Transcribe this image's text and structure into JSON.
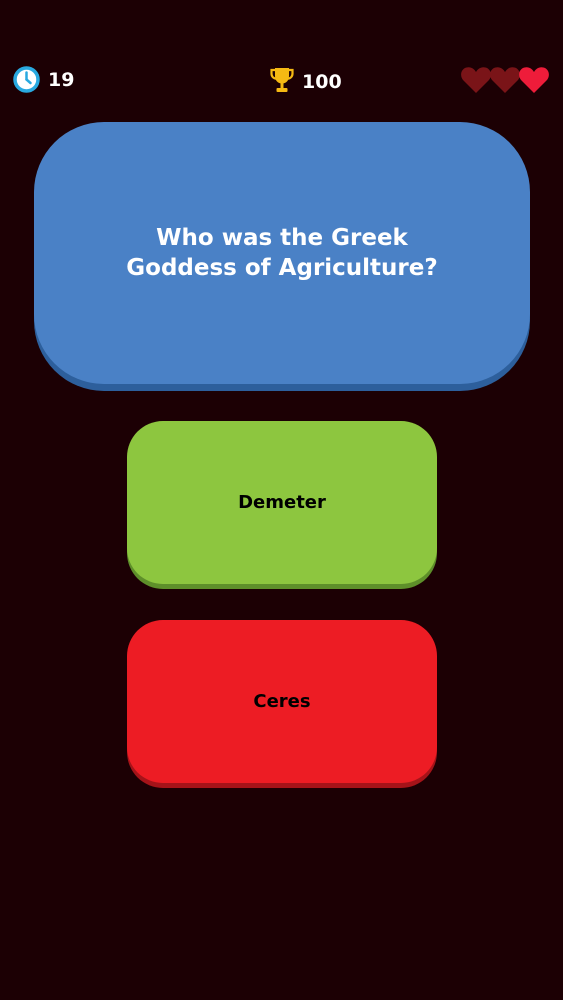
{
  "hud": {
    "timer_value": "19",
    "timer_icon": "clock-icon",
    "score_value": "100",
    "score_icon": "trophy-icon",
    "lives_total": 3,
    "lives_remaining": 1
  },
  "question": {
    "text": "Who was the Greek Goddess of Agriculture?"
  },
  "answers": [
    {
      "label": "Demeter",
      "color": "#8dc63f"
    },
    {
      "label": "Ceres",
      "color": "#ed1c24"
    }
  ],
  "colors": {
    "background": "#1c0004",
    "question_card": "#4a81c6",
    "heart_active": "#ee1c3a",
    "heart_lost": "#7a1418",
    "trophy": "#f5b913",
    "clock": "#29a9e0"
  }
}
